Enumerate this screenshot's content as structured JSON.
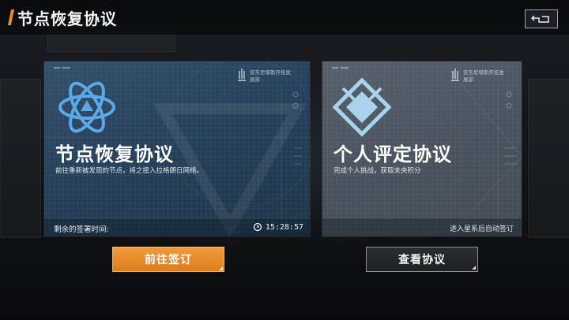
{
  "header": {
    "title": "节点恢复协议"
  },
  "cards": {
    "node": {
      "title": "节点恢复协议",
      "description": "前往重新被发现的节点，将之接入拉格朗日网络。",
      "org": "安东尼堪斯开拓发展部",
      "footer_label": "剩余的签署时间:",
      "timer": "15:28:57",
      "emblem_icon": "atom-star-icon",
      "accent": "#33506b"
    },
    "personal": {
      "title": "个人评定协议",
      "description": "完成个人挑战，获取未央积分",
      "org": "安东尼堪斯开拓发展部",
      "footer_note": "进入星系后自动签订",
      "emblem_icon": "diamond-badge-icon",
      "accent": "#56606c"
    }
  },
  "buttons": {
    "sign": "前往签订",
    "view": "查看协议"
  },
  "colors": {
    "accent_orange": "#e88a2a",
    "button_orange": "#f19b3a"
  }
}
